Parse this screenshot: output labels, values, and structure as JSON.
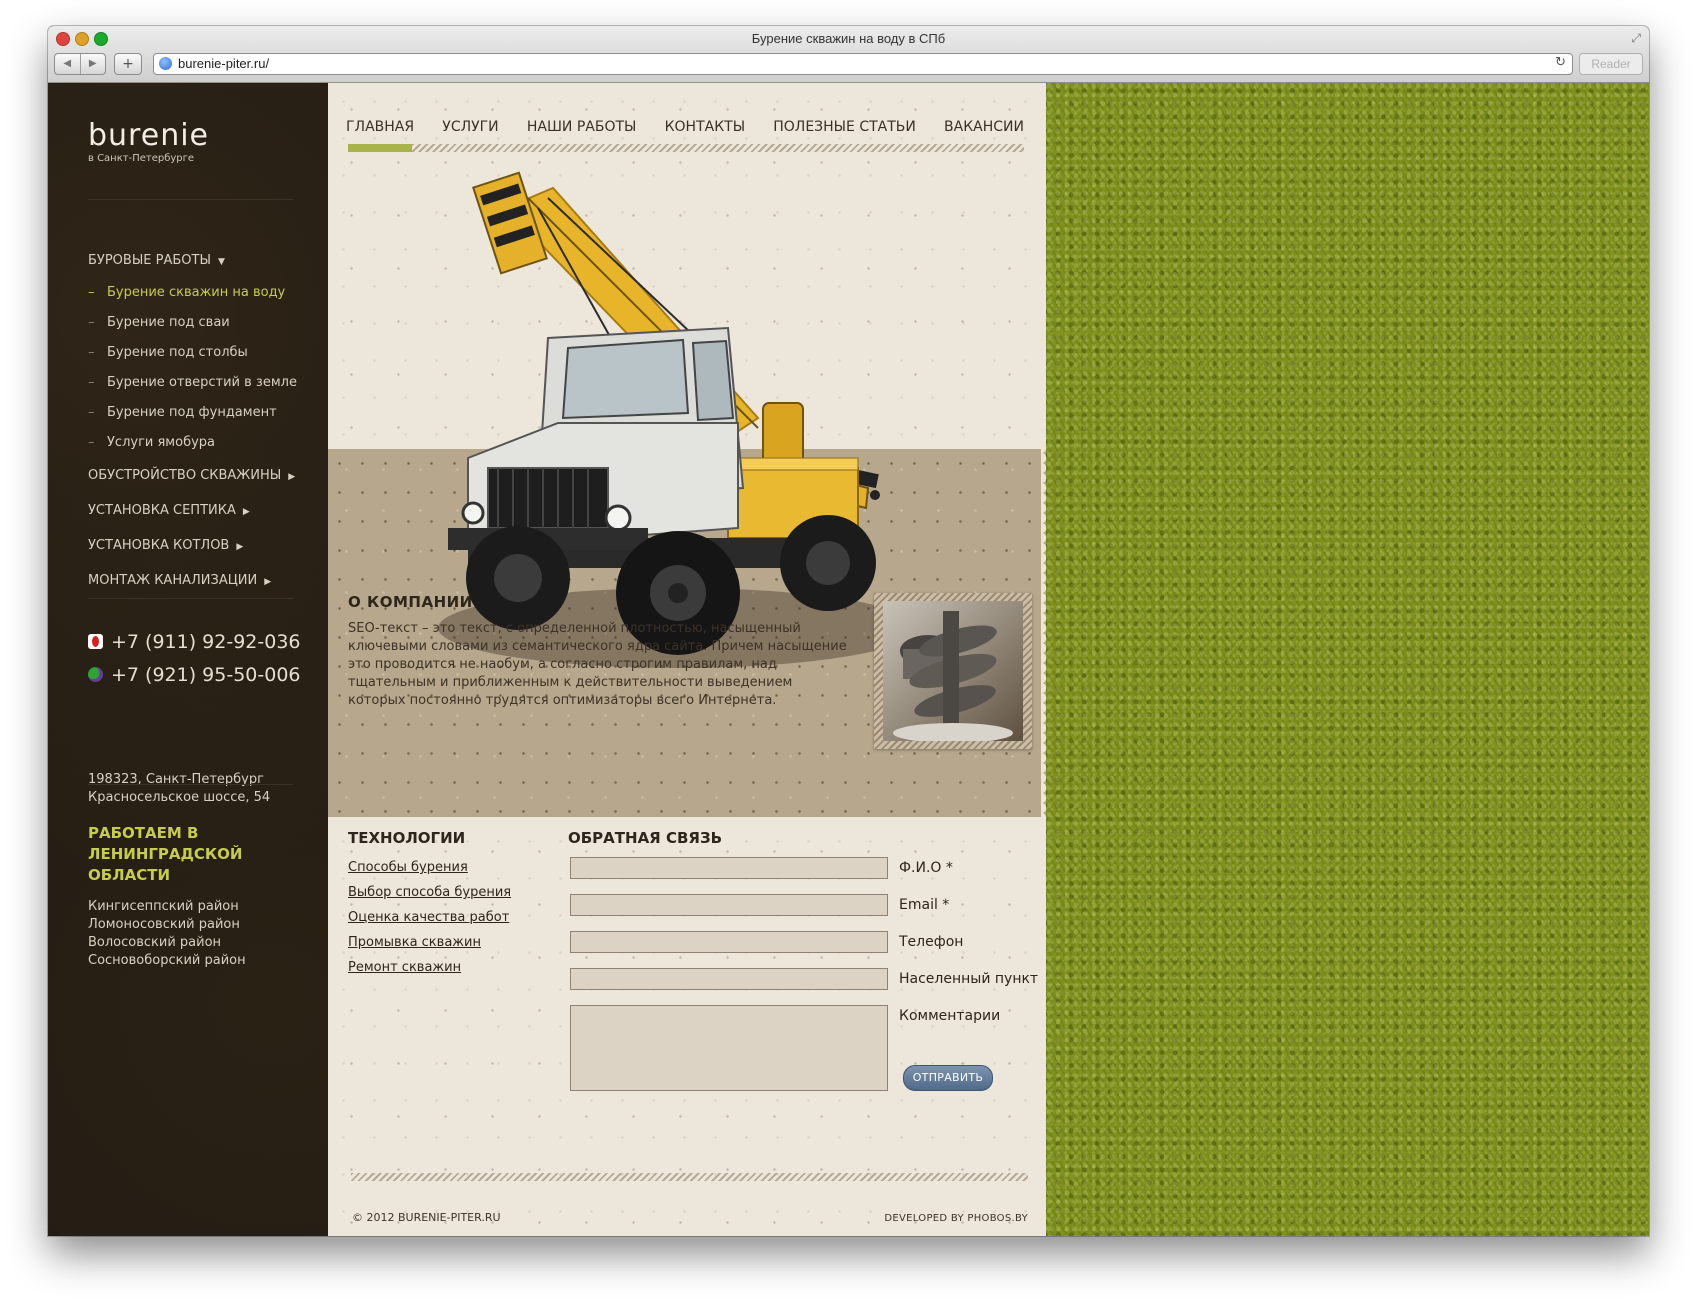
{
  "browser": {
    "window_title": "Бурение скважин на воду в СПб",
    "url": "burenie-piter.ru/",
    "reader_label": "Reader",
    "back_glyph": "◀",
    "forward_glyph": "▶",
    "add_glyph": "+",
    "reload_glyph": "↻",
    "fullscreen_glyph": "⤢"
  },
  "sidebar": {
    "logo_text": "burenie",
    "logo_subtitle": "в Санкт-Петербурге",
    "menu": [
      {
        "label": "БУРОВЫЕ РАБОТЫ",
        "caret": "▼"
      },
      {
        "label": "ОБУСТРОЙСТВО СКВАЖИНЫ",
        "caret": "▶"
      },
      {
        "label": "УСТАНОВКА СЕПТИКА",
        "caret": "▶"
      },
      {
        "label": "УСТАНОВКА КОТЛОВ",
        "caret": "▶"
      },
      {
        "label": "МОНТАЖ КАНАЛИЗАЦИИ",
        "caret": "▶"
      }
    ],
    "submenu": [
      {
        "dash": "–",
        "label": "Бурение скважин на воду"
      },
      {
        "dash": "–",
        "label": "Бурение под сваи"
      },
      {
        "dash": "–",
        "label": "Бурение под столбы"
      },
      {
        "dash": "–",
        "label": "Бурение отверстий в земле"
      },
      {
        "dash": "–",
        "label": "Бурение под фундамент"
      },
      {
        "dash": "–",
        "label": "Услуги ямобура"
      }
    ],
    "phones": [
      "+7 (911) 92-92-036",
      "+7 (921) 95-50-006"
    ],
    "address_line1": "198323, Санкт-Петербург",
    "address_line2": "Красносельское шоссе, 54",
    "region_title": "РАБОТАЕМ В ЛЕНИНГРАДСКОЙ ОБЛАСТИ",
    "regions": [
      "Кингисеппский район",
      "Ломоносовский район",
      "Волосовский район",
      "Сосновоборский район"
    ]
  },
  "topnav": [
    "ГЛАВНАЯ",
    "УСЛУГИ",
    "НАШИ РАБОТЫ",
    "КОНТАКТЫ",
    "ПОЛЕЗНЫЕ СТАТЬИ",
    "ВАКАНСИИ"
  ],
  "about": {
    "title": "О КОМПАНИИ",
    "text": "SEO-текст – это текст, с определенной плотностью, насыщенный ключевыми словами из семантического ядра сайта. Причем насыщение это проводится не наобум, а согласно строгим правилам, над тщательным и приближенным к действительности выведением которых постоянно трудятся оптимизаторы всего Интернета."
  },
  "technologies": {
    "title": "ТЕХНОЛОГИИ",
    "links": [
      "Способы бурения",
      "Выбор способа бурения",
      "Оценка качества работ",
      "Промывка скважин",
      "Ремонт скважин"
    ]
  },
  "feedback": {
    "title": "ОБРАТНАЯ СВЯЗЬ",
    "fields": [
      "Ф.И.О *",
      "Email *",
      "Телефон",
      "Населенный пункт"
    ],
    "comment_label": "Комментарии",
    "submit_label": "ОТПРАВИТЬ"
  },
  "footer": {
    "copyright": "© 2012 BURENIE-PITER.RU",
    "developer": "DEVELOPED BY PHOBOS.BY"
  },
  "colors": {
    "sidebar_bg": "#211a12",
    "accent_green": "#c6cd4c",
    "nav_active": "#a8b34a",
    "paper_bg": "#ece6db",
    "band_bg": "#b7a78c",
    "button_blue": "#5f7898"
  }
}
